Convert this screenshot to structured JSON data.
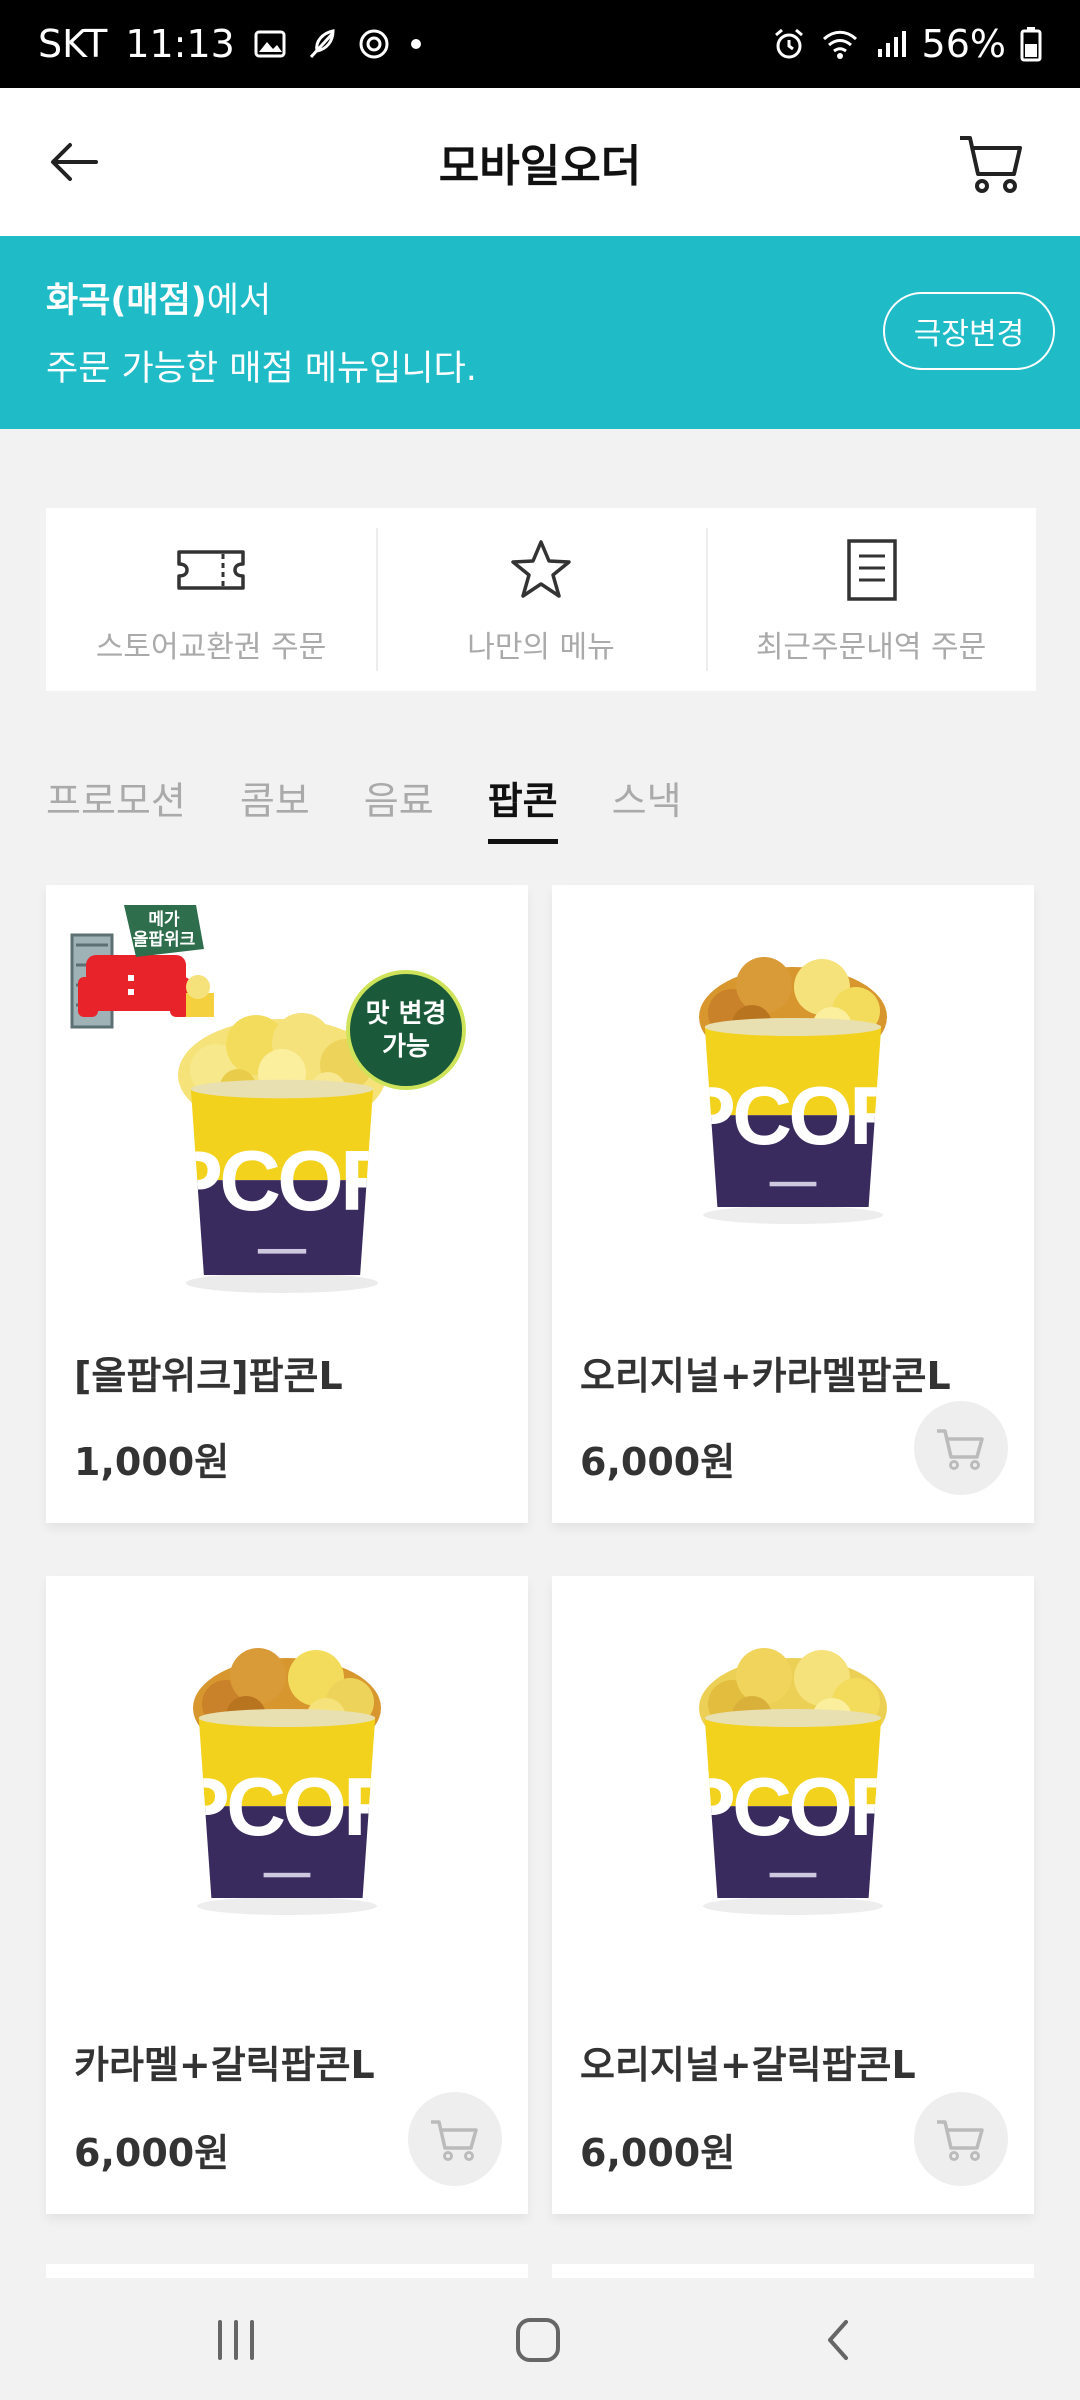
{
  "status_bar": {
    "carrier": "SKT",
    "time": "11:13",
    "battery": "56%"
  },
  "header": {
    "title": "모바일오더"
  },
  "banner": {
    "theater": "화곡(매점)",
    "line1_suffix": "에서",
    "line2": "주문 가능한 매점 메뉴입니다.",
    "change_label": "극장변경",
    "background_color": "#1fbcc8"
  },
  "quick_menu": [
    {
      "label": "스토어교환권 주문",
      "icon": "ticket-icon"
    },
    {
      "label": "나만의 메뉴",
      "icon": "star-icon"
    },
    {
      "label": "최근주문내역 주문",
      "icon": "receipt-icon"
    }
  ],
  "tabs": [
    {
      "label": "프로모션",
      "active": false
    },
    {
      "label": "콤보",
      "active": false
    },
    {
      "label": "음료",
      "active": false
    },
    {
      "label": "팝콘",
      "active": true
    },
    {
      "label": "스낵",
      "active": false
    }
  ],
  "products": [
    {
      "name": "[올팝위크]팝콘L",
      "price": "1,000원",
      "badge_event": "메가 올팝위크",
      "badge_flavor": "맛 변경 가능"
    },
    {
      "name": "오리지널+카라멜팝콘L",
      "price": "6,000원"
    },
    {
      "name": "카라멜+갈릭팝콘L",
      "price": "6,000원"
    },
    {
      "name": "오리지널+갈릭팝콘L",
      "price": "6,000원"
    }
  ],
  "popcorn_cup_text": "PCOR",
  "colors": {
    "accent": "#1fbcc8",
    "cup_yellow": "#f2d21d",
    "cup_purple": "#3a2b5e"
  }
}
